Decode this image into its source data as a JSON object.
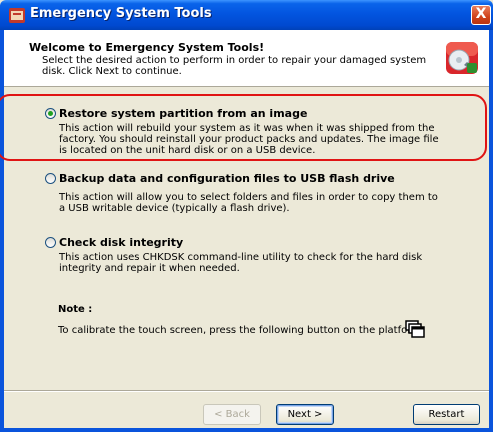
{
  "window": {
    "title": "Emergency System Tools",
    "close_label": "X"
  },
  "header": {
    "title": "Welcome to Emergency System Tools!",
    "description": "Select the desired action to perform in order to repair your damaged system disk. Click Next to continue."
  },
  "options": [
    {
      "label": "Restore system partition from an image",
      "description": "This action will rebuild your system as it was when it was shipped from the factory. You should reinstall your product packs and updates. The image file is located on the unit hard disk or on a USB device.",
      "selected": true
    },
    {
      "label": "Backup data and configuration files to USB flash drive",
      "description": "This action will allow you to select folders and files in order to copy them to a USB writable device (typically a flash drive).",
      "selected": false
    },
    {
      "label": "Check disk integrity",
      "description": "This action uses CHKDSK command-line utility to check for the hard disk integrity and repair it when needed.",
      "selected": false
    }
  ],
  "note": {
    "title": "Note :",
    "text": "To calibrate the touch screen, press the following button on the platform:"
  },
  "buttons": {
    "back": "< Back",
    "next": "Next >",
    "restart": "Restart"
  },
  "colors": {
    "titlebar": "#0055e5",
    "highlight": "#e01414",
    "radio_checked": "#21a121"
  }
}
